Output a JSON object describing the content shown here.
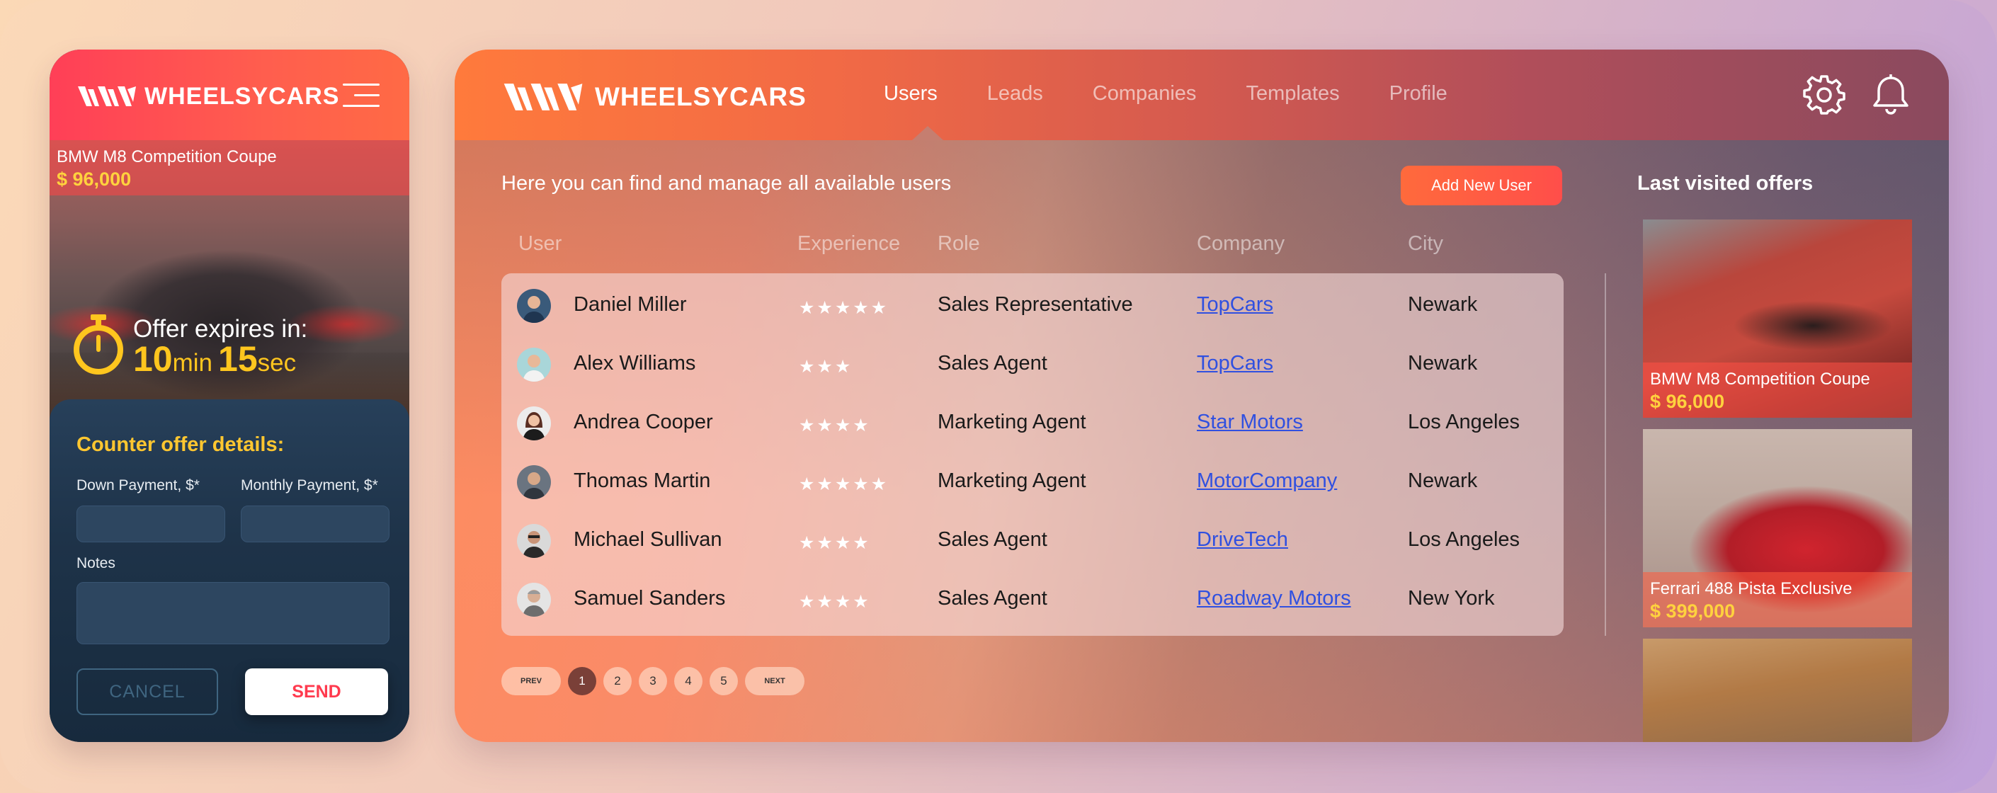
{
  "brand": {
    "name": "WHEELSYCARS"
  },
  "colors": {
    "accent": "#ff4e4a",
    "price": "#ffd23e",
    "link": "#3050e0",
    "timer": "#ffc61e"
  },
  "mobile": {
    "offer": {
      "title": "BMW M8 Competition Coupe",
      "price": "$ 96,000"
    },
    "timer": {
      "label": "Offer expires in:",
      "minutes": "10",
      "min_unit": "min",
      "seconds": "15",
      "sec_unit": "sec"
    },
    "form": {
      "title": "Counter offer details:",
      "down_payment_label": "Down Payment, $*",
      "monthly_payment_label": "Monthly Payment, $*",
      "notes_label": "Notes",
      "down_payment_value": "",
      "monthly_payment_value": "",
      "notes_value": "",
      "cancel_label": "CANCEL",
      "send_label": "SEND"
    },
    "menu_icon": "hamburger-icon"
  },
  "desktop": {
    "nav": {
      "tabs": [
        {
          "label": "Users",
          "active": true
        },
        {
          "label": "Leads",
          "active": false
        },
        {
          "label": "Companies",
          "active": false
        },
        {
          "label": "Templates",
          "active": false
        },
        {
          "label": "Profile",
          "active": false
        }
      ],
      "icons": [
        "gear-icon",
        "bell-icon"
      ]
    },
    "intro": "Here you can  find and manage all available users",
    "add_user_label": "Add New User",
    "table": {
      "headers": [
        "User",
        "Experience",
        "Role",
        "Company",
        "City"
      ],
      "rows": [
        {
          "name": "Daniel Miller",
          "stars": "★★★★★",
          "rating": 5,
          "role": "Sales Representative",
          "company": "TopCars",
          "city": "Newark"
        },
        {
          "name": "Alex Williams",
          "stars": "★★★",
          "rating": 3,
          "role": "Sales Agent",
          "company": "TopCars",
          "city": "Newark"
        },
        {
          "name": "Andrea Cooper",
          "stars": "★★★★",
          "rating": 4,
          "role": "Marketing Agent",
          "company": "Star Motors",
          "city": "Los Angeles"
        },
        {
          "name": "Thomas Martin",
          "stars": "★★★★★",
          "rating": 5,
          "role": "Marketing Agent",
          "company": "MotorCompany",
          "city": "Newark"
        },
        {
          "name": "Michael Sullivan",
          "stars": "★★★★",
          "rating": 4,
          "role": "Sales Agent",
          "company": "DriveTech",
          "city": "Los Angeles"
        },
        {
          "name": "Samuel Sanders",
          "stars": "★★★★",
          "rating": 4,
          "role": "Sales Agent",
          "company": "Roadway Motors",
          "city": "New York"
        }
      ]
    },
    "pagination": {
      "prev": "PREV",
      "pages": [
        "1",
        "2",
        "3",
        "4",
        "5"
      ],
      "current": "1",
      "next": "NEXT"
    },
    "last_visited": {
      "title": "Last visited offers",
      "offers": [
        {
          "title": "BMW M8 Competition Coupe",
          "price": "$ 96,000"
        },
        {
          "title": "Ferrari 488 Pista Exclusive",
          "price": "$ 399,000"
        }
      ]
    }
  }
}
